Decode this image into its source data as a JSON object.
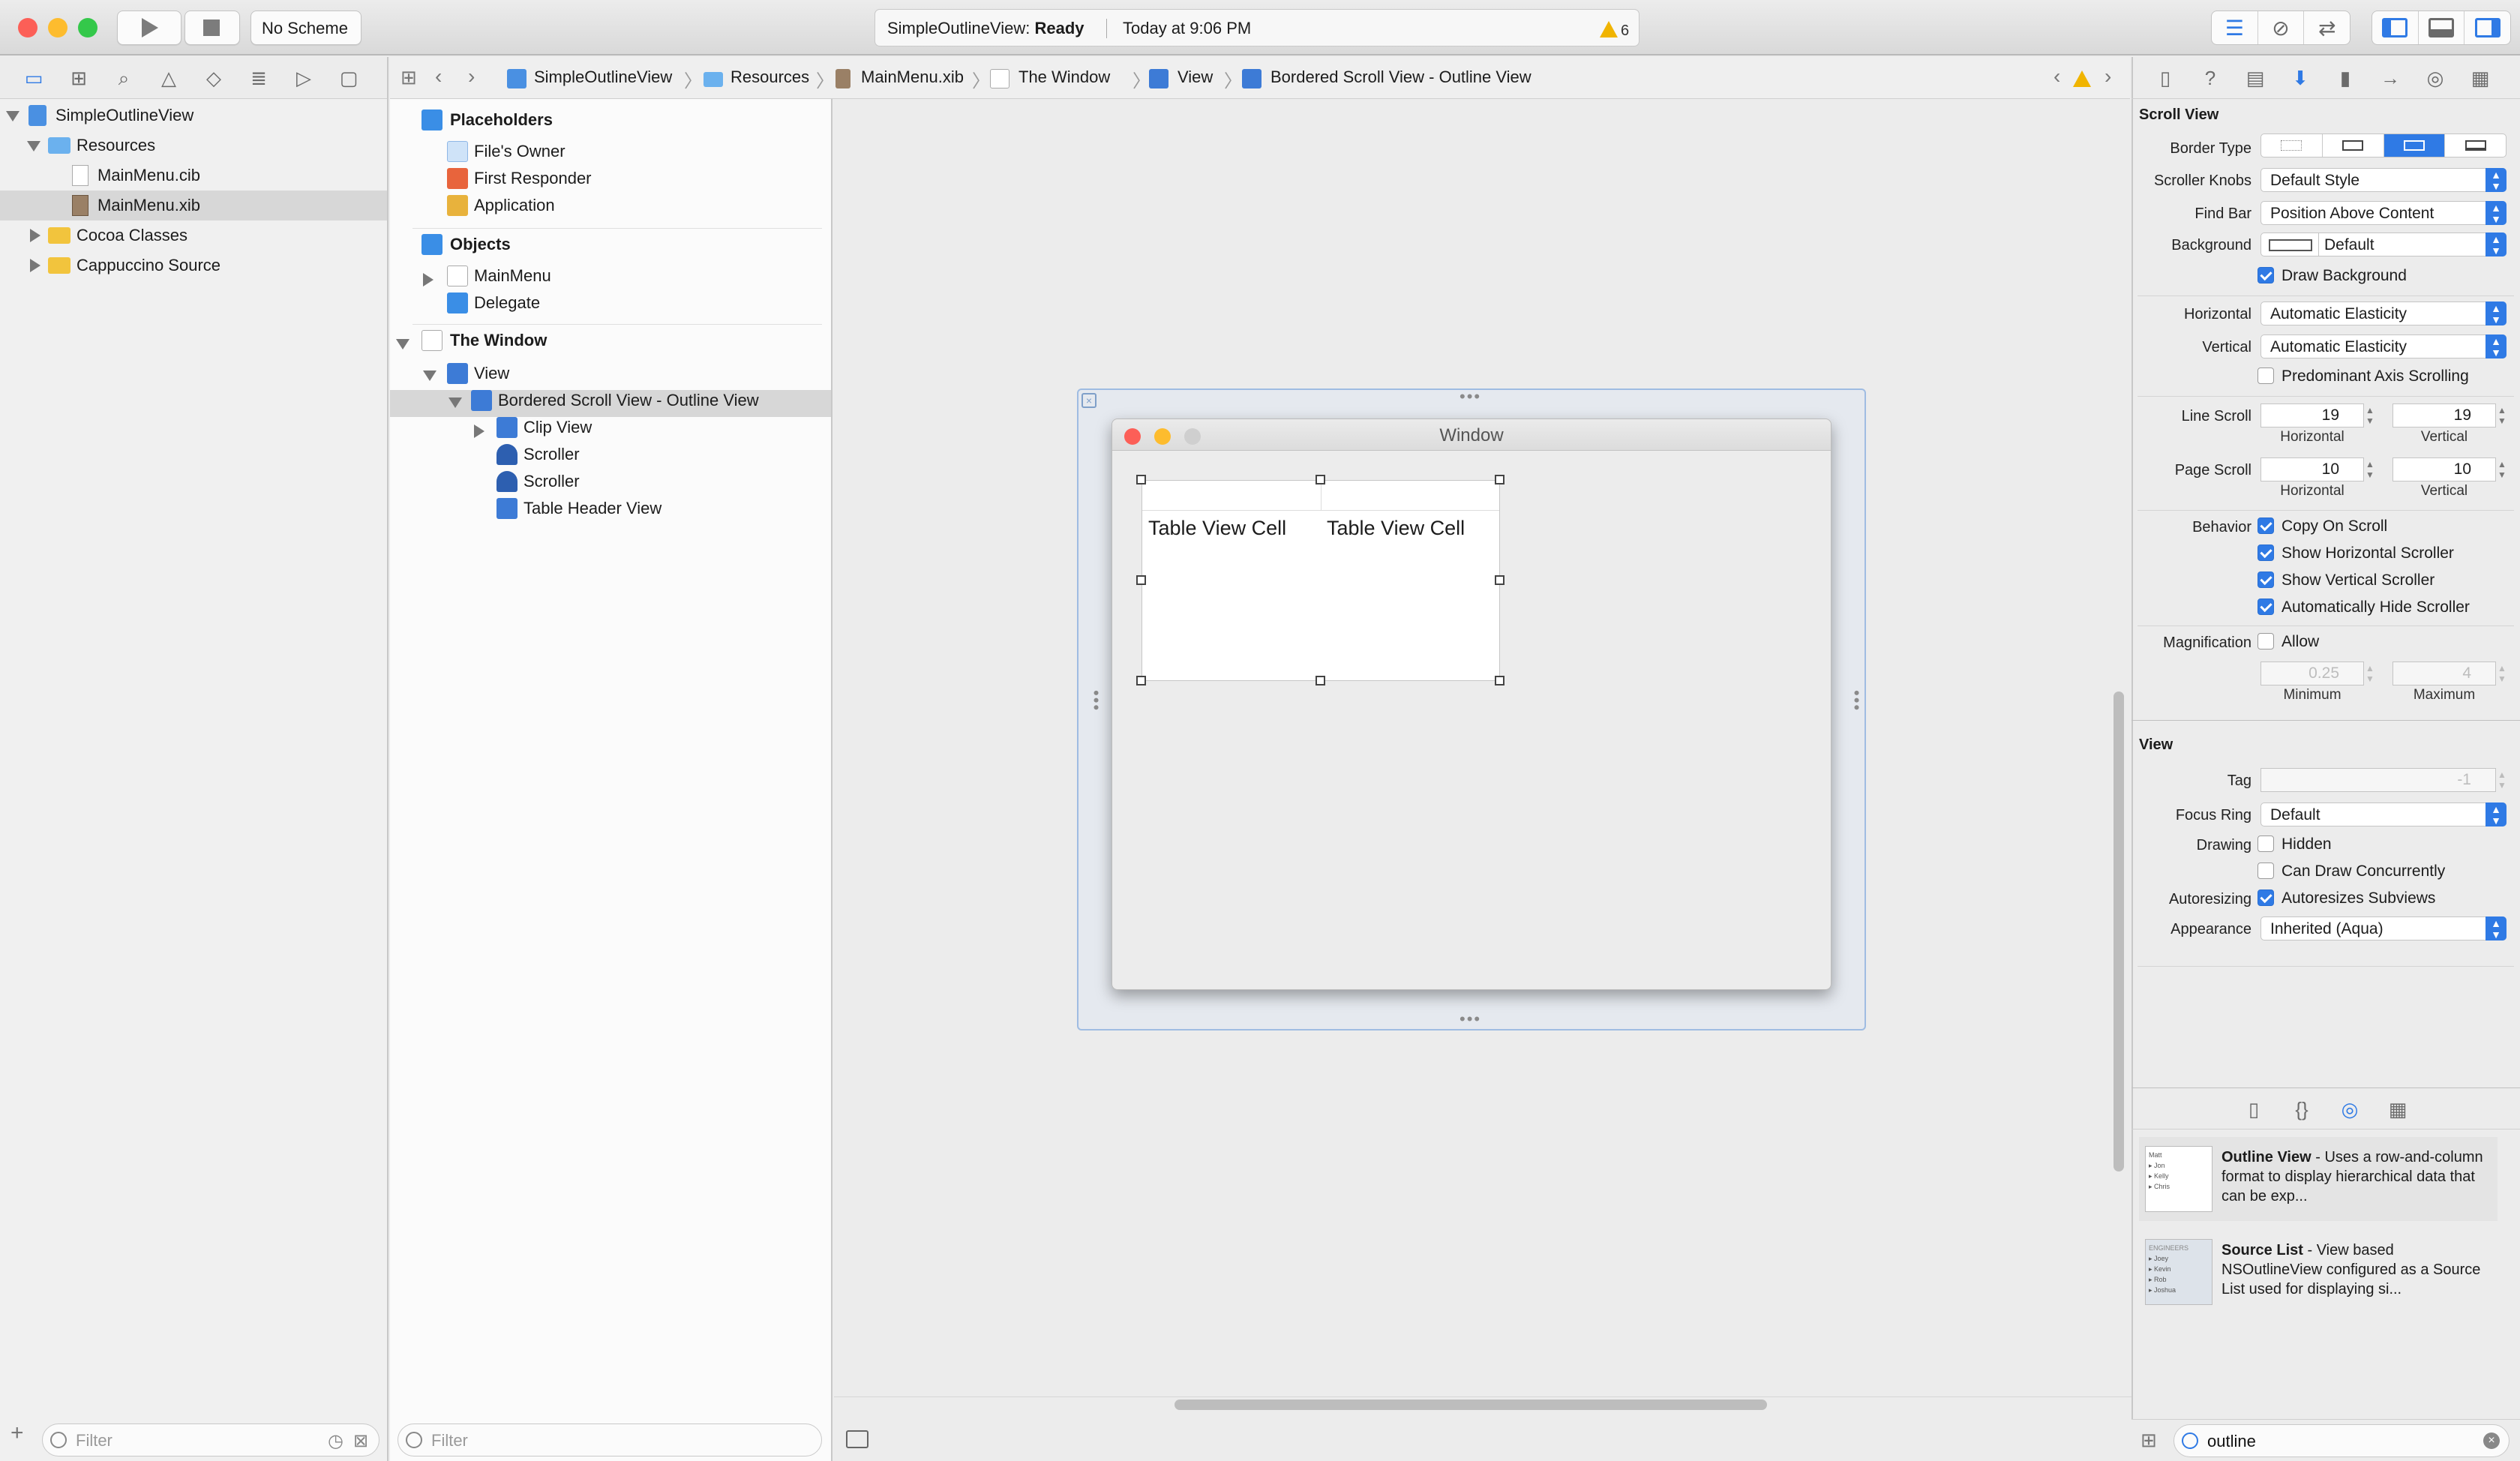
{
  "toolbar": {
    "scheme": "No Scheme",
    "status_project": "SimpleOutlineView:",
    "status_state": "Ready",
    "status_time": "Today at 9:06 PM",
    "warning_count": "6"
  },
  "navigator": {
    "items": [
      {
        "label": "SimpleOutlineView"
      },
      {
        "label": "Resources"
      },
      {
        "label": "MainMenu.cib"
      },
      {
        "label": "MainMenu.xib"
      },
      {
        "label": "Cocoa Classes"
      },
      {
        "label": "Cappuccino Source"
      }
    ],
    "filter_placeholder": "Filter"
  },
  "jumpbar": {
    "crumbs": [
      "SimpleOutlineView",
      "Resources",
      "MainMenu.xib",
      "The Window",
      "View",
      "Bordered Scroll View - Outline View"
    ]
  },
  "outline": {
    "placeholders_title": "Placeholders",
    "placeholders": [
      "File's Owner",
      "First Responder",
      "Application"
    ],
    "objects_title": "Objects",
    "objects": [
      "MainMenu",
      "Delegate"
    ],
    "window_title": "The Window",
    "view": "View",
    "scroll_view": "Bordered Scroll View - Outline View",
    "children": [
      "Clip View",
      "Scroller",
      "Scroller",
      "Table Header View"
    ],
    "filter_placeholder": "Filter"
  },
  "canvas": {
    "window_title": "Window",
    "cell_1": "Table View Cell",
    "cell_2": "Table View Cell"
  },
  "inspector": {
    "scroll_view_title": "Scroll View",
    "border_type_label": "Border Type",
    "scroller_knobs_label": "Scroller Knobs",
    "scroller_knobs_value": "Default Style",
    "find_bar_label": "Find Bar",
    "find_bar_value": "Position Above Content",
    "background_label": "Background",
    "background_value": "Default",
    "draw_background": "Draw Background",
    "horizontal_label": "Horizontal",
    "horizontal_value": "Automatic Elasticity",
    "vertical_label": "Vertical",
    "vertical_value": "Automatic Elasticity",
    "predominant": "Predominant Axis Scrolling",
    "line_scroll_label": "Line Scroll",
    "line_scroll_h": "19",
    "line_scroll_v": "19",
    "page_scroll_label": "Page Scroll",
    "page_scroll_h": "10",
    "page_scroll_v": "10",
    "sub_horizontal": "Horizontal",
    "sub_vertical": "Vertical",
    "behavior_label": "Behavior",
    "copy_on_scroll": "Copy On Scroll",
    "show_h_scroller": "Show Horizontal Scroller",
    "show_v_scroller": "Show Vertical Scroller",
    "auto_hide": "Automatically Hide Scroller",
    "magnification_label": "Magnification",
    "allow": "Allow",
    "min_value": "0.25",
    "max_value": "4",
    "sub_minimum": "Minimum",
    "sub_maximum": "Maximum",
    "view_title": "View",
    "tag_label": "Tag",
    "tag_value": "-1",
    "focus_ring_label": "Focus Ring",
    "focus_ring_value": "Default",
    "drawing_label": "Drawing",
    "hidden": "Hidden",
    "can_draw": "Can Draw Concurrently",
    "autoresizing_label": "Autoresizing",
    "autoresizes": "Autoresizes Subviews",
    "appearance_label": "Appearance",
    "appearance_value": "Inherited (Aqua)"
  },
  "library": {
    "items": [
      {
        "title": "Outline View",
        "desc": " - Uses a row-and-column format to display hierarchical data that can be exp..."
      },
      {
        "title": "Source List",
        "desc": " - View based NSOutlineView configured as a Source List used for displaying si..."
      }
    ],
    "thumb1": [
      "Matt",
      "Jon",
      "Kelly",
      "Chris"
    ],
    "thumb2": [
      "ENGINEERS",
      "Joey",
      "Kevin",
      "Rob",
      "Joshua"
    ],
    "search_value": "outline"
  },
  "colors": {
    "accent": "#2f7ae5",
    "close": "#fc5f57",
    "minimize": "#fdbc2e",
    "zoom": "#34c84a"
  }
}
